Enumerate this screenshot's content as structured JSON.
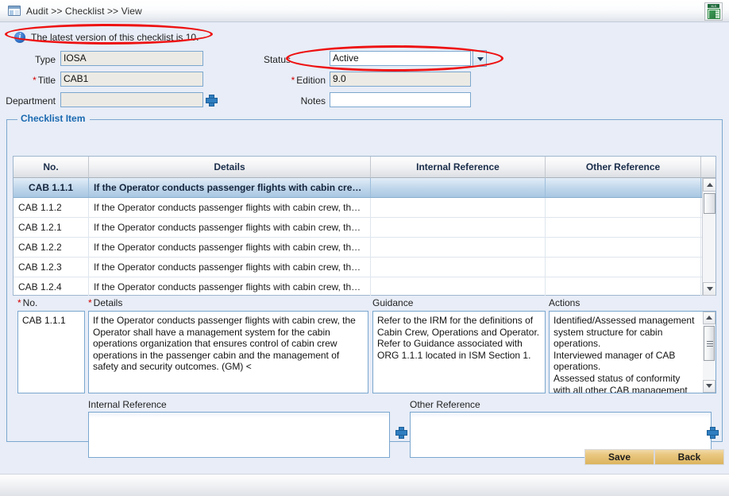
{
  "window": {
    "breadcrumb": "Audit >> Checklist >> View",
    "breadcrumb_icon": "panel-icon",
    "export_icon": "xls-export-icon",
    "export_icon_label": "XLS"
  },
  "info": {
    "icon": "info-icon",
    "message": "The latest version of this checklist is 10."
  },
  "form": {
    "type": {
      "label": "Type",
      "value": "IOSA",
      "required": false
    },
    "title": {
      "label": "Title",
      "value": "CAB1",
      "required": true
    },
    "department": {
      "label": "Department",
      "value": "",
      "required": false,
      "add_icon": "plus-icon"
    },
    "status": {
      "label": "Status",
      "value": "Active",
      "required": false,
      "dropdown_icon": "chevron-down-icon"
    },
    "edition": {
      "label": "Edition",
      "value": "9.0",
      "required": true
    },
    "notes": {
      "label": "Notes",
      "value": "",
      "required": false
    }
  },
  "fieldset": {
    "legend": "Checklist Item"
  },
  "grid": {
    "columns": [
      "No.",
      "Details",
      "Internal Reference",
      "Other Reference"
    ],
    "rows": [
      {
        "no": "CAB 1.1.1",
        "details": "If the Operator conducts passenger flights with cabin cre…",
        "internal": "",
        "other": "",
        "selected": true
      },
      {
        "no": "CAB 1.1.2",
        "details": "If the Operator conducts passenger flights with cabin crew, th…",
        "internal": "",
        "other": "",
        "selected": false
      },
      {
        "no": "CAB 1.2.1",
        "details": "If the Operator conducts passenger flights with cabin crew, th…",
        "internal": "",
        "other": "",
        "selected": false
      },
      {
        "no": "CAB 1.2.2",
        "details": "If the Operator conducts passenger flights with cabin crew, th…",
        "internal": "",
        "other": "",
        "selected": false
      },
      {
        "no": "CAB 1.2.3",
        "details": "If the Operator conducts passenger flights with cabin crew, th…",
        "internal": "",
        "other": "",
        "selected": false
      },
      {
        "no": "CAB 1.2.4",
        "details": "If the Operator conducts passenger flights with cabin crew, th…",
        "internal": "",
        "other": "",
        "selected": false
      }
    ]
  },
  "detail": {
    "no": {
      "label": "No.",
      "required": true,
      "value": "CAB 1.1.1"
    },
    "details": {
      "label": "Details",
      "required": true,
      "value": "If the Operator conducts passenger flights with cabin crew, the Operator shall have a management system for the cabin operations organization that ensures control of cabin crew operations in the passenger cabin and the management of safety and security outcomes. (GM) <"
    },
    "guidance": {
      "label": "Guidance",
      "required": false,
      "value": "Refer to the IRM for the definitions of Cabin Crew, Operations and Operator.\nRefer to Guidance associated with ORG 1.1.1 located in ISM Section 1."
    },
    "actions": {
      "label": "Actions",
      "required": false,
      "value": "Identified/Assessed management system structure for cabin operations.\nInterviewed manager of CAB operations.\nAssessed status of conformity with all other CAB management"
    }
  },
  "references": {
    "internal": {
      "label": "Internal Reference",
      "value": "",
      "add_icon": "plus-icon"
    },
    "other": {
      "label": "Other Reference",
      "value": "",
      "add_icon": "plus-icon"
    }
  },
  "buttons": {
    "save": "Save",
    "back": "Back"
  },
  "colors": {
    "page_background": "#e8edf7",
    "field_border": "#7ba7cf",
    "legend_text": "#1a69b0",
    "required_marker": "#d40000",
    "annotation_ellipse": "#ee1111",
    "button_gold": "#e9c77f",
    "selected_row": "#a8c7e2"
  }
}
